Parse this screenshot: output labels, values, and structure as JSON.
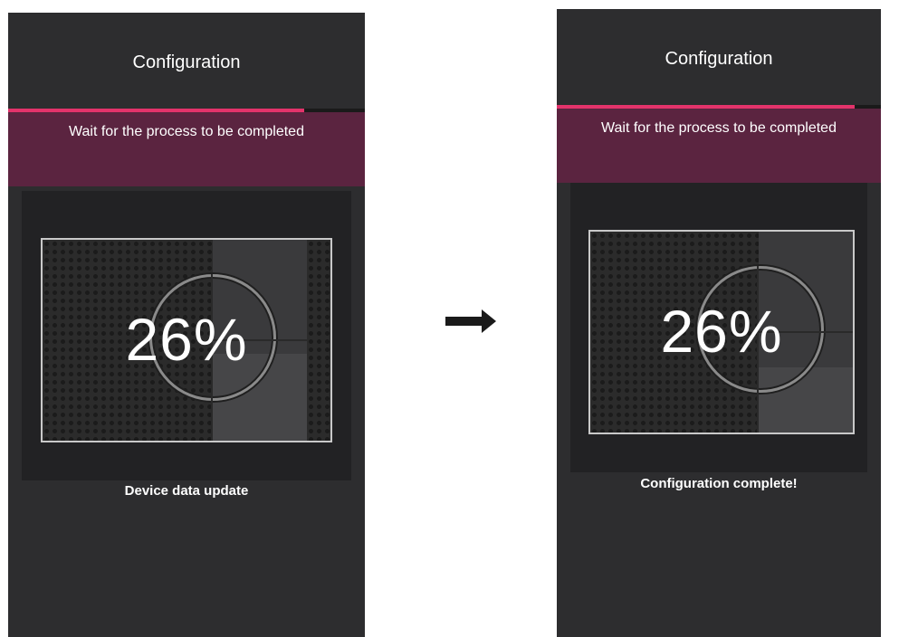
{
  "screens": [
    {
      "title": "Configuration",
      "progress": 0.83,
      "banner": "Wait for the process to be completed",
      "percent_label": "26%",
      "status": "Device data update"
    },
    {
      "title": "Configuration",
      "progress": 0.92,
      "banner": "Wait for the process to be completed",
      "percent_label": "26%",
      "status": "Configuration complete!"
    }
  ],
  "arrow_icon": "arrow-right-icon",
  "colors": {
    "accent": "#e3336b",
    "banner": "#5b2440",
    "background": "#2d2d2f"
  }
}
